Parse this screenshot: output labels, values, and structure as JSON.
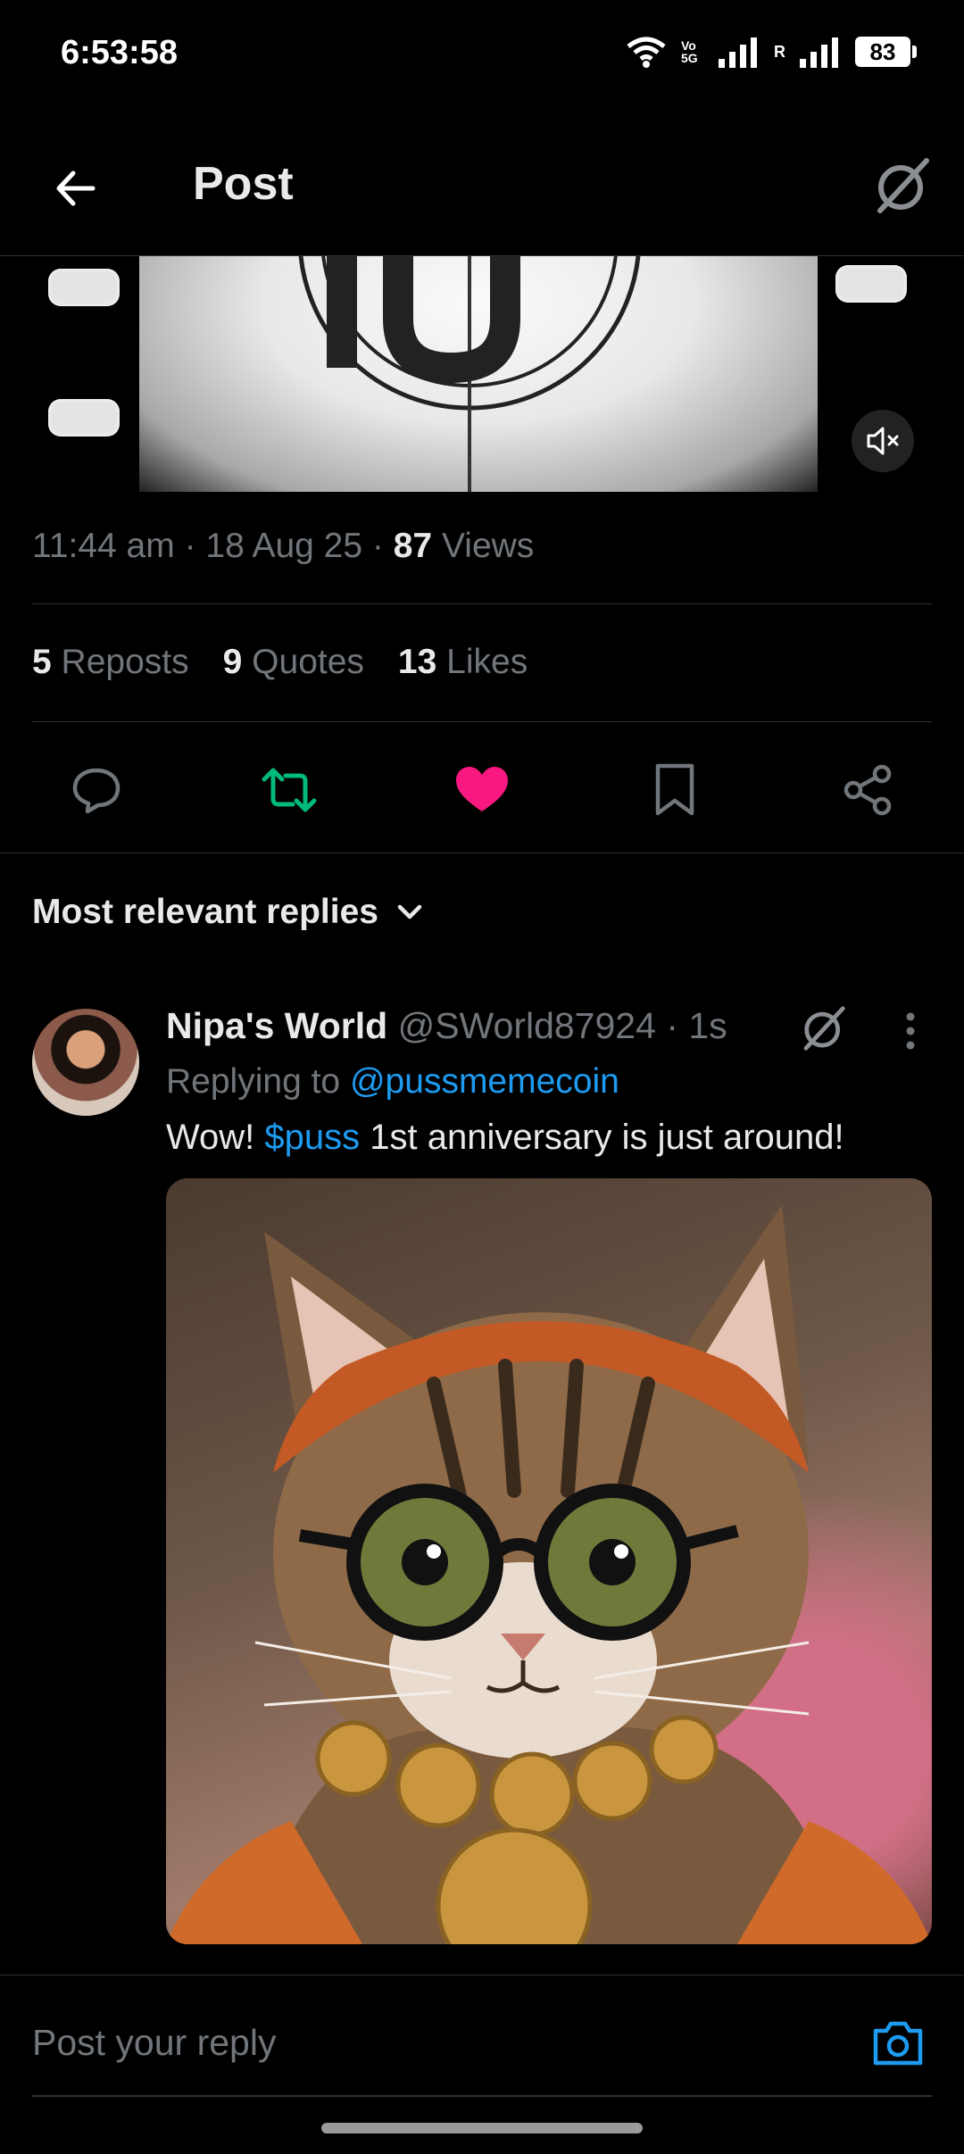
{
  "status_bar": {
    "time": "6:53:58",
    "battery": "83",
    "network_label": "Vo 5G",
    "roaming": "R"
  },
  "header": {
    "title": "Post"
  },
  "post": {
    "time": "11:44 am",
    "date": "18 Aug 25",
    "views_count": "87",
    "views_label": "Views",
    "reposts_count": "5",
    "reposts_label": "Reposts",
    "quotes_count": "9",
    "quotes_label": "Quotes",
    "likes_count": "13",
    "likes_label": "Likes",
    "liked": true,
    "reposted": true,
    "media_muted": true
  },
  "replies": {
    "sort_label": "Most relevant replies",
    "items": [
      {
        "name": "Nipa's World",
        "handle": "@SWorld87924",
        "time": "1s",
        "replying_prefix": "Replying to",
        "replying_to": "@pussmemecoin",
        "text_before": "Wow! ",
        "cashtag": "$puss",
        "text_after": " 1st anniversary is just around!"
      }
    ]
  },
  "composer": {
    "placeholder": "Post your reply"
  },
  "colors": {
    "accent": "#1d9bf0",
    "like": "#f91880",
    "repost": "#00ba7c",
    "muted_text": "#71767b"
  }
}
